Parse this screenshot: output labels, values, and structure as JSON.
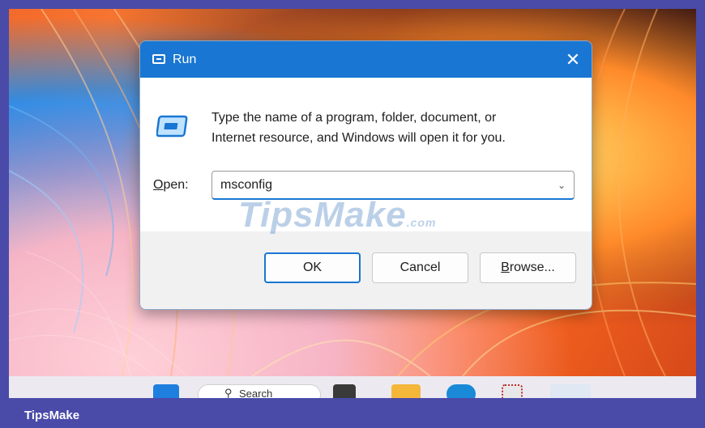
{
  "dialog": {
    "title": "Run",
    "close_label": "✕",
    "description_line1": "Type the name of a program, folder, document, or",
    "description_line2": "Internet resource, and Windows will open it for you.",
    "open_label_mnemonic": "O",
    "open_label_rest": "pen:",
    "open_value": "msconfig",
    "ok_label": "OK",
    "cancel_label": "Cancel",
    "browse_label_mnemonic": "B",
    "browse_label_rest": "rowse..."
  },
  "watermark": {
    "text": "TipsMake",
    "suffix": ".com"
  },
  "taskbar": {
    "search_label": "Search"
  },
  "footer": {
    "brand": "TipsMake"
  },
  "colors": {
    "accent": "#1976d2",
    "frame": "#4a4aa8"
  }
}
